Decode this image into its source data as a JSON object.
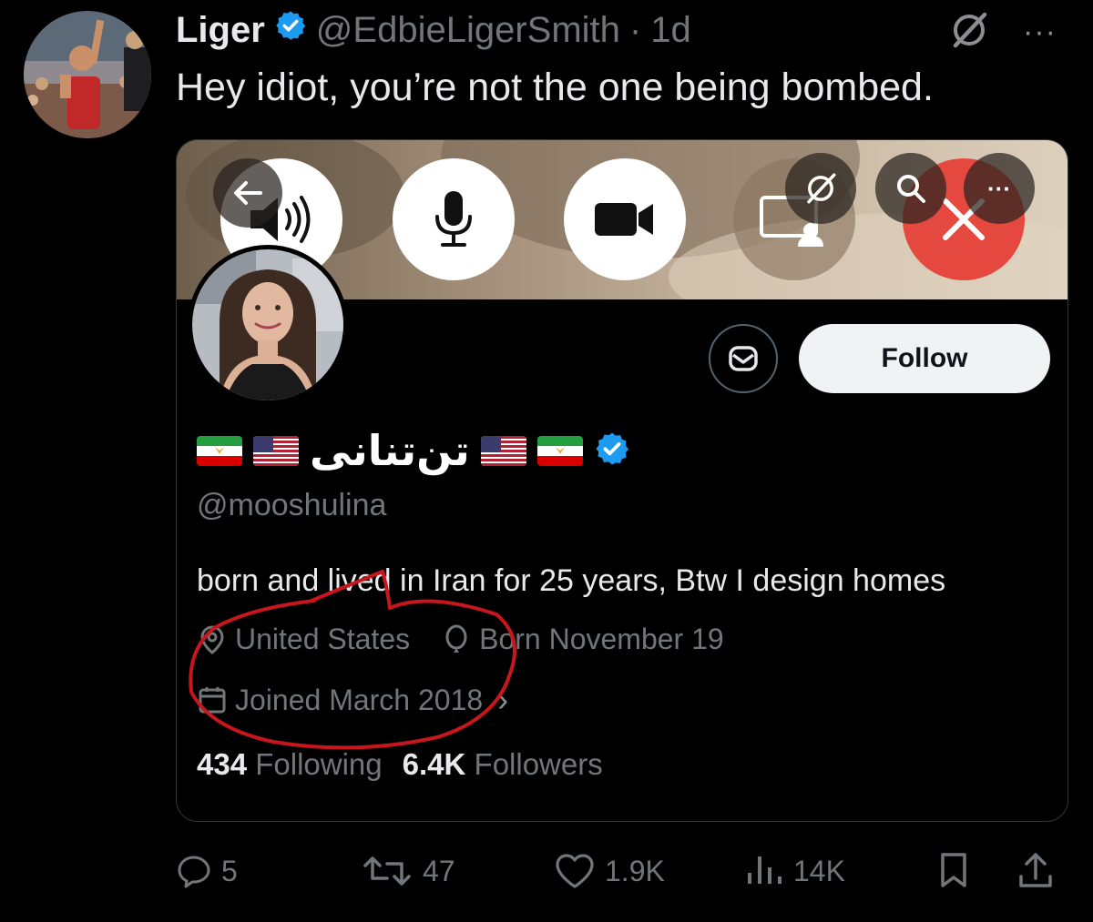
{
  "tweet": {
    "display_name": "Liger",
    "handle": "@EdbieLigerSmith",
    "separator": "·",
    "time": "1d",
    "text": "Hey idiot, you’re not the one being bombed.",
    "more": "···"
  },
  "profile_card": {
    "follow_label": "Follow",
    "display_name": "تن‌تنانی",
    "handle": "@mooshulina",
    "bio": "born and lived in Iran for 25 years, Btw I design homes",
    "location": "United States",
    "birthday": "Born November 19",
    "joined": "Joined March 2018",
    "joined_chevron": "›",
    "following_count": "434",
    "following_label": "Following",
    "followers_count": "6.4K",
    "followers_label": "Followers",
    "more": "···"
  },
  "actions": {
    "replies": "5",
    "reposts": "47",
    "likes": "1.9K",
    "views": "14K"
  },
  "colors": {
    "verified": "#1d9bf0",
    "muted": "#71767b",
    "annotation": "#c8161d",
    "end_call": "#e5483f"
  },
  "icons": [
    "verified-badge-icon",
    "grok-icon",
    "more-icon",
    "speaker-icon",
    "mic-icon",
    "video-icon",
    "share-screen-icon",
    "end-call-icon",
    "back-arrow-icon",
    "search-icon",
    "message-icon",
    "location-icon",
    "balloon-icon",
    "calendar-icon",
    "reply-icon",
    "repost-icon",
    "like-icon",
    "views-icon",
    "bookmark-icon",
    "share-icon"
  ]
}
